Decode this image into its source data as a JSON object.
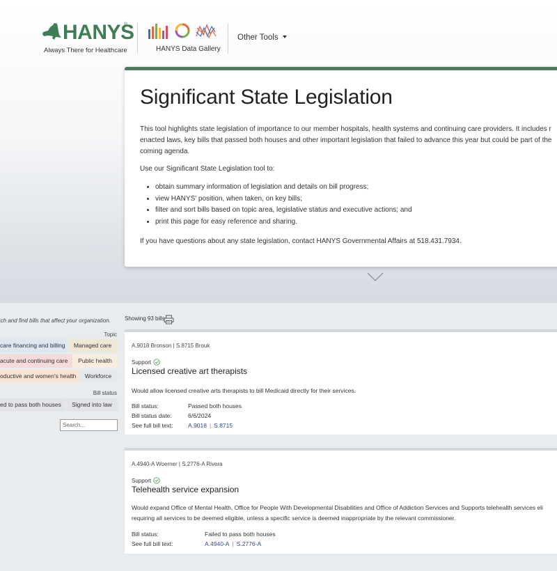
{
  "header": {
    "logo": {
      "wordmark": "HANYS",
      "registered": "®",
      "tagline": "Always There for Healthcare"
    },
    "gallery_label": "HANYS Data Gallery",
    "other_tools_label": "Other Tools",
    "colors": {
      "brand_green": "#3f7d55"
    }
  },
  "intro": {
    "title": "Significant State Legislation",
    "paragraph1": "This tool highlights state legislation of importance to our member hospitals, health systems and continuing care providers. It includes r enacted laws, key bills that passed both houses and other important legislation that failed to advance this year but could be part of the coming agenda.",
    "paragraph2": "Use our Significant State Legislation tool to:",
    "bullets": [
      "obtain summary information of legislation and details on bill progress;",
      "view HANYS' position, when taken, on key bills;",
      "filter and sort bills based on topic area, legislative status and executive actions; and",
      "print this page for easy reference and sharing."
    ],
    "paragraph3": "If you have questions about any state legislation, contact HANYS Governmental Affairs at 518.431.7934.",
    "accent_color": "#4f7b5e"
  },
  "filters": {
    "intro_text": "rch and find bills that affect your organization.",
    "topic_label": "Topic",
    "topics": [
      {
        "label": "care financing and billing",
        "color": "#dde6f3"
      },
      {
        "label": "Managed care",
        "color": "#efe7d6"
      },
      {
        "label": "acute and continuing care",
        "color": "#f6d9d9"
      },
      {
        "label": "Public health",
        "color": "#f9ede0"
      },
      {
        "label": "oductive and women's health",
        "color": "#f8e4d5"
      },
      {
        "label": "Workforce",
        "color": "#e6e8ec"
      }
    ],
    "status_label": "Bill status",
    "statuses": [
      {
        "label": "ed to pass both houses",
        "color": "#e2e4e8"
      },
      {
        "label": "Signed into law",
        "color": "#e2e4e8"
      }
    ],
    "search_placeholder": "Search..."
  },
  "results": {
    "showing_text": "Showing 93 bills",
    "bills": [
      {
        "sponsors": "A.9018 Bronson | S.8715 Brouk",
        "position": "Support",
        "title": "Licensed creative art therapists",
        "description": "Would allow licensed creative arts therapists to bill Medicaid directly for their services.",
        "status_label": "Bill status:",
        "status_value": "Passed both houses",
        "date_label": "Bill status date:",
        "date_value": "6/6/2024",
        "fulltext_label": "See full bill text:",
        "links": [
          "A.9018",
          "S.8715"
        ]
      },
      {
        "sponsors": "A.4940-A Woerner | S.2776-A Rivera",
        "position": "Support",
        "title": "Telehealth service expansion",
        "description": "Would expand Office of Mental Health, Office for People With Developmental Disabilities and Office of Addiction Services and Supports telehealth services eli requiring all services to be deemed eligible, unless a specific service is deemed inappropriate by the relevant commissioner.",
        "status_label": "Bill status:",
        "status_value": "Failed to pass both houses",
        "fulltext_label": "See full bill text:",
        "links": [
          "A.4940-A",
          "S.2776-A"
        ]
      }
    ]
  }
}
